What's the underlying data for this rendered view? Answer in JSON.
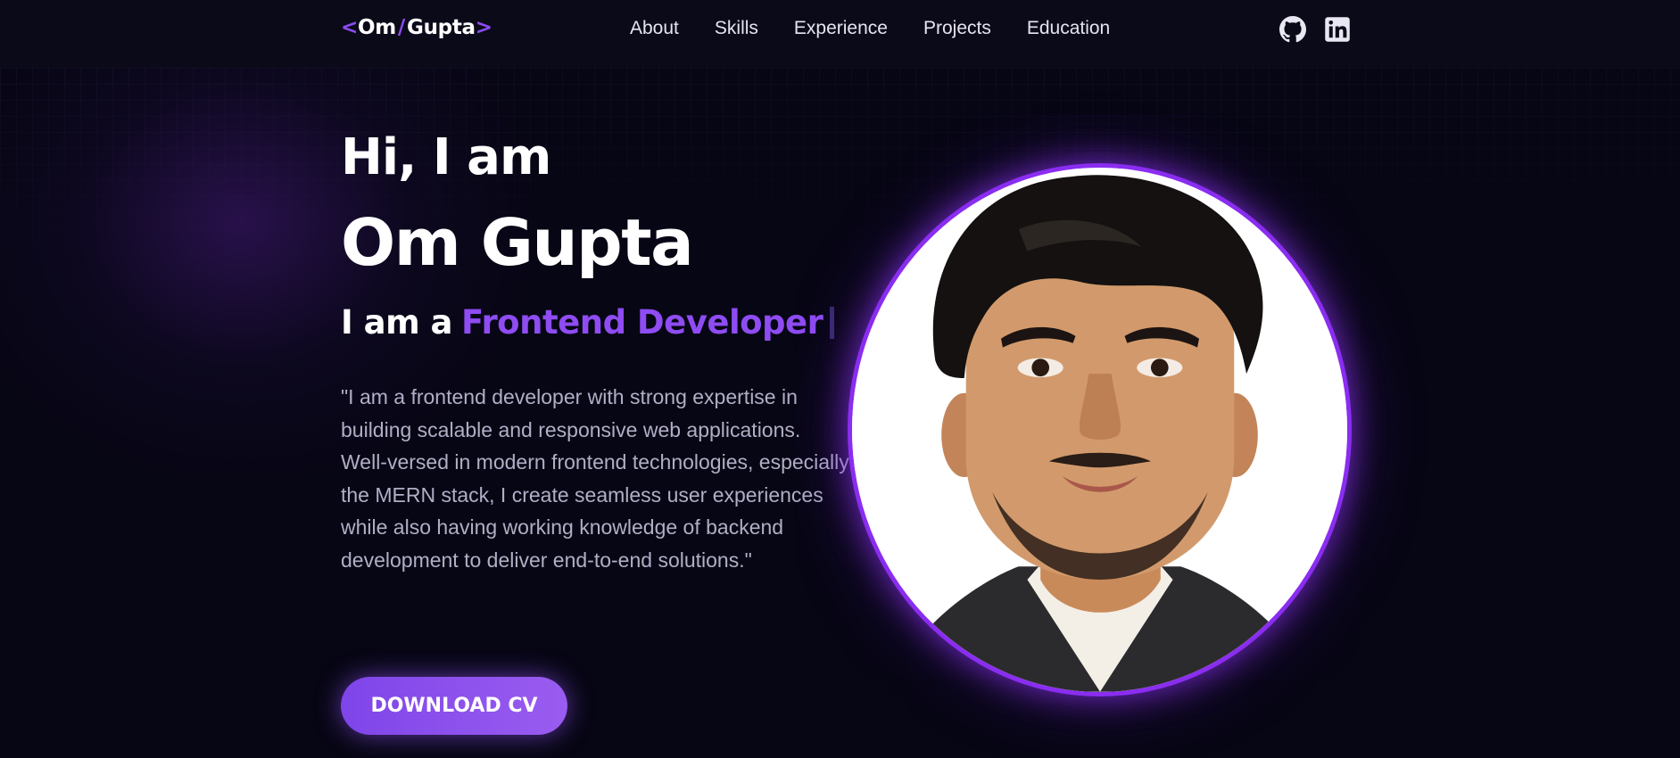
{
  "logo": {
    "open_bracket": "<",
    "first": "Om",
    "slash": "/",
    "last": "Gupta",
    "close_bracket": ">"
  },
  "nav": {
    "links": [
      "About",
      "Skills",
      "Experience",
      "Projects",
      "Education"
    ]
  },
  "social": {
    "icons": [
      "github-icon",
      "linkedin-icon"
    ]
  },
  "hero": {
    "greeting": "Hi, I am",
    "name": "Om Gupta",
    "role_prefix": "I am a",
    "role": "Frontend Developer",
    "bio": "\"I am a frontend developer with strong expertise in building scalable and responsive web applications. Well-versed in modern frontend technologies, especially the MERN stack, I create seamless user experiences while also having working knowledge of backend development to deliver end-to-end solutions.\"",
    "cv_button": "DOWNLOAD CV"
  },
  "colors": {
    "background": "#070614",
    "navbar": "#0b0a19",
    "accent": "#8e4cf2",
    "portrait_ring": "#8a2df0",
    "bio_text": "#b1aec6"
  }
}
